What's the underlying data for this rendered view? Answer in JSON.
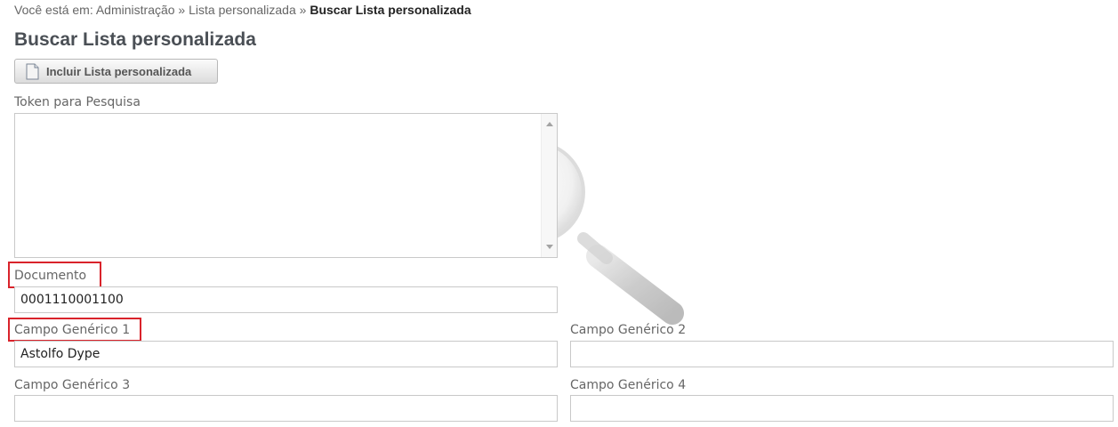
{
  "breadcrumb": {
    "prefix": "Você está em: ",
    "items": [
      "Administração",
      "Lista personalizada"
    ],
    "separator": " » ",
    "current": "Buscar Lista personalizada"
  },
  "page": {
    "title": "Buscar Lista personalizada",
    "include_button_label": "Incluir Lista personalizada"
  },
  "form": {
    "token": {
      "label": "Token para Pesquisa",
      "value": ""
    },
    "documento": {
      "label": "Documento",
      "value": "0001110001100"
    },
    "campo1": {
      "label": "Campo Genérico 1",
      "value": "Astolfo Dype"
    },
    "campo2": {
      "label": "Campo Genérico 2",
      "value": ""
    },
    "campo3": {
      "label": "Campo Genérico 3",
      "value": ""
    },
    "campo4": {
      "label": "Campo Genérico 4",
      "value": ""
    }
  },
  "icons": {
    "include_button_icon": "document-icon",
    "background_watermark": "magnifier-icon"
  },
  "colors": {
    "highlight": "#d9232b"
  }
}
